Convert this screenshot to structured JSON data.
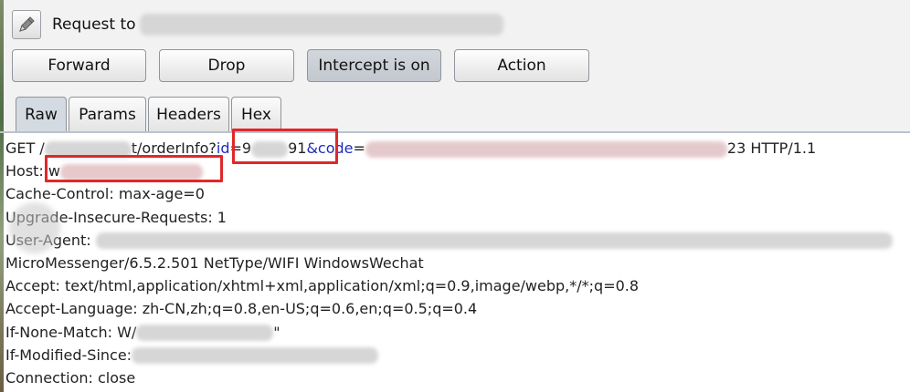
{
  "title": {
    "label": "Request to"
  },
  "buttons": {
    "forward": "Forward",
    "drop": "Drop",
    "intercept": "Intercept is on",
    "action": "Action"
  },
  "tabs": {
    "raw": "Raw",
    "params": "Params",
    "headers": "Headers",
    "hex": "Hex"
  },
  "request": {
    "method": "GET /",
    "path_tail": "t/orderInfo?",
    "id_key": "id",
    "eq": "=",
    "id_visible_start": "9",
    "id_visible_end": "91",
    "amp": "&",
    "code_key": "code",
    "code_visible_end": "23",
    "protocol": " HTTP/1.1",
    "host_label": "Host: ",
    "host_visible_start": "w",
    "cache_control": "Cache-Control: max-age=0",
    "upgrade": "Upgrade-Insecure-Requests: 1",
    "user_agent_label": "User-Agent: ",
    "micromessenger": "MicroMessenger/6.5.2.501 NetType/WIFI WindowsWechat",
    "accept": "Accept: text/html,application/xhtml+xml,application/xml;q=0.9,image/webp,*/*;q=0.8",
    "accept_language": "Accept-Language: zh-CN,zh;q=0.8,en-US;q=0.6,en;q=0.5;q=0.4",
    "if_none_match": "If-None-Match: W/",
    "if_none_match_end": "\"",
    "if_modified_since": "If-Modified-Since:",
    "connection": "Connection: close"
  },
  "colors": {
    "param_key": "#1f2bbd",
    "highlight_border": "#e0282a",
    "active_tab": "#d4dae1",
    "intercept_on": "#c8cdd3"
  },
  "icons": {
    "edit": "pencil-icon"
  }
}
